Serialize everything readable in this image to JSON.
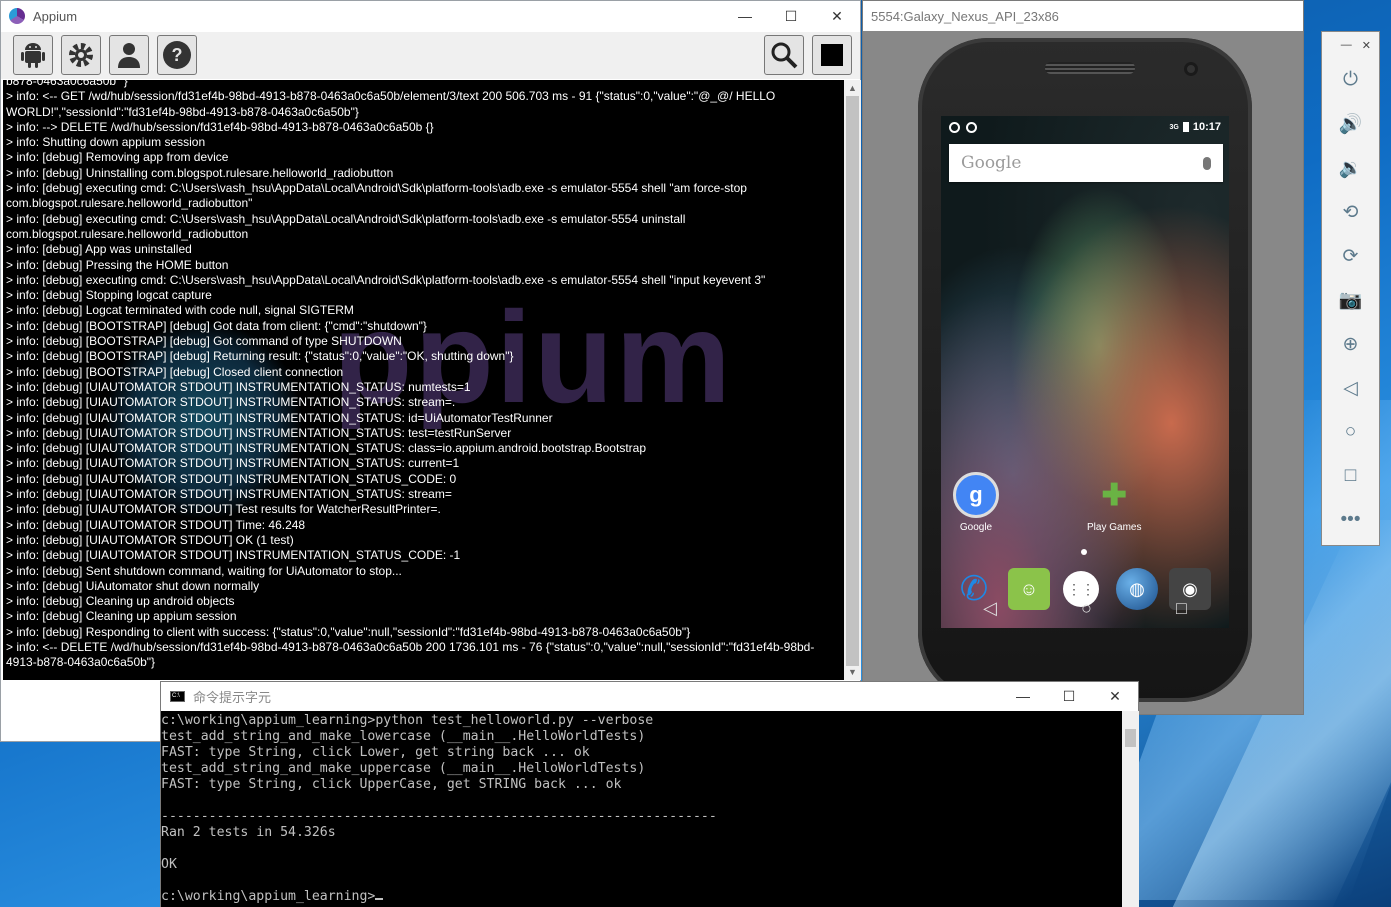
{
  "appium": {
    "title": "Appium",
    "toolbar": {
      "android_button": "android-icon",
      "settings_button": "gear-icon",
      "user_button": "user-icon",
      "help_button": "help-icon",
      "inspector_button": "magnifier-icon",
      "stop_button": "stop-icon"
    },
    "log_lines": [
      "b878-0463a0c6a50b\" }",
      "> info: <-- GET /wd/hub/session/fd31ef4b-98bd-4913-b878-0463a0c6a50b/element/3/text 200 506.703 ms - 91 {\"status\":0,\"value\":\"@_@/ HELLO WORLD!\",\"sessionId\":\"fd31ef4b-98bd-4913-b878-0463a0c6a50b\"}",
      "> info: --> DELETE /wd/hub/session/fd31ef4b-98bd-4913-b878-0463a0c6a50b {}",
      "> info: Shutting down appium session",
      "> info: [debug] Removing app from device",
      "> info: [debug] Uninstalling com.blogspot.rulesare.helloworld_radiobutton",
      "> info: [debug] executing cmd: C:\\Users\\vash_hsu\\AppData\\Local\\Android\\Sdk\\platform-tools\\adb.exe -s emulator-5554 shell \"am force-stop com.blogspot.rulesare.helloworld_radiobutton\"",
      "> info: [debug] executing cmd: C:\\Users\\vash_hsu\\AppData\\Local\\Android\\Sdk\\platform-tools\\adb.exe -s emulator-5554 uninstall com.blogspot.rulesare.helloworld_radiobutton",
      "> info: [debug] App was uninstalled",
      "> info: [debug] Pressing the HOME button",
      "> info: [debug] executing cmd: C:\\Users\\vash_hsu\\AppData\\Local\\Android\\Sdk\\platform-tools\\adb.exe -s emulator-5554 shell \"input keyevent 3\"",
      "> info: [debug] Stopping logcat capture",
      "> info: [debug] Logcat terminated with code null, signal SIGTERM",
      "> info: [debug] [BOOTSTRAP] [debug] Got data from client: {\"cmd\":\"shutdown\"}",
      "> info: [debug] [BOOTSTRAP] [debug] Got command of type SHUTDOWN",
      "> info: [debug] [BOOTSTRAP] [debug] Returning result: {\"status\":0,\"value\":\"OK, shutting down\"}",
      "> info: [debug] [BOOTSTRAP] [debug] Closed client connection",
      "> info: [debug] [UIAUTOMATOR STDOUT] INSTRUMENTATION_STATUS: numtests=1",
      "> info: [debug] [UIAUTOMATOR STDOUT] INSTRUMENTATION_STATUS: stream=.",
      "> info: [debug] [UIAUTOMATOR STDOUT] INSTRUMENTATION_STATUS: id=UiAutomatorTestRunner",
      "> info: [debug] [UIAUTOMATOR STDOUT] INSTRUMENTATION_STATUS: test=testRunServer",
      "> info: [debug] [UIAUTOMATOR STDOUT] INSTRUMENTATION_STATUS: class=io.appium.android.bootstrap.Bootstrap",
      "> info: [debug] [UIAUTOMATOR STDOUT] INSTRUMENTATION_STATUS: current=1",
      "> info: [debug] [UIAUTOMATOR STDOUT] INSTRUMENTATION_STATUS_CODE: 0",
      "> info: [debug] [UIAUTOMATOR STDOUT] INSTRUMENTATION_STATUS: stream=",
      "> info: [debug] [UIAUTOMATOR STDOUT] Test results for WatcherResultPrinter=.",
      "> info: [debug] [UIAUTOMATOR STDOUT] Time: 46.248",
      "> info: [debug] [UIAUTOMATOR STDOUT] OK (1 test)",
      "> info: [debug] [UIAUTOMATOR STDOUT] INSTRUMENTATION_STATUS_CODE: -1",
      "> info: [debug] Sent shutdown command, waiting for UiAutomator to stop...",
      "> info: [debug] UiAutomator shut down normally",
      "> info: [debug] Cleaning up android objects",
      "> info: [debug] Cleaning up appium session",
      "> info: [debug] Responding to client with success: {\"status\":0,\"value\":null,\"sessionId\":\"fd31ef4b-98bd-4913-b878-0463a0c6a50b\"}",
      "> info: <-- DELETE /wd/hub/session/fd31ef4b-98bd-4913-b878-0463a0c6a50b 200 1736.101 ms - 76 {\"status\":0,\"value\":null,\"sessionId\":\"fd31ef4b-98bd-4913-b878-0463a0c6a50b\"}"
    ],
    "watermark": "ppium"
  },
  "emulator": {
    "title": "5554:Galaxy_Nexus_API_23x86",
    "status_time": "10:17",
    "status_signal": "3G",
    "search_placeholder": "Google",
    "apps": [
      {
        "label": "Google",
        "icon": "google-search-icon",
        "glyph": "g",
        "color": "#4285f4"
      },
      {
        "label": "Play Games",
        "icon": "gamepad-icon",
        "glyph": "✚",
        "color": "#6ab344"
      }
    ],
    "dock": [
      {
        "icon": "phone-icon",
        "glyph": "✆",
        "color": "#1e88e5"
      },
      {
        "icon": "messaging-icon",
        "glyph": "☺",
        "color": "#8bc34a"
      },
      {
        "icon": "app-drawer-icon",
        "glyph": "⋮⋮",
        "color": "#ffffff"
      },
      {
        "icon": "browser-globe-icon",
        "glyph": "◍",
        "color": "#2a6fb0"
      },
      {
        "icon": "camera-icon",
        "glyph": "◉",
        "color": "#555555"
      }
    ],
    "nav": [
      "◁",
      "○",
      "□"
    ]
  },
  "emu_sidebar": {
    "min_label": "—",
    "close_label": "✕",
    "buttons": [
      {
        "name": "power-icon",
        "glyph": "⏻"
      },
      {
        "name": "volume-up-icon",
        "glyph": "🔊"
      },
      {
        "name": "volume-down-icon",
        "glyph": "🔉"
      },
      {
        "name": "rotate-left-icon",
        "glyph": "⟲"
      },
      {
        "name": "rotate-right-icon",
        "glyph": "⟳"
      },
      {
        "name": "screenshot-icon",
        "glyph": "📷"
      },
      {
        "name": "zoom-icon",
        "glyph": "⊕"
      },
      {
        "name": "back-icon",
        "glyph": "◁"
      },
      {
        "name": "home-icon",
        "glyph": "○"
      },
      {
        "name": "overview-icon",
        "glyph": "□"
      },
      {
        "name": "more-icon",
        "glyph": "•••"
      }
    ]
  },
  "cmd": {
    "title": "命令提示字元",
    "lines": [
      "c:\\working\\appium_learning>python test_helloworld.py --verbose",
      "test_add_string_and_make_lowercase (__main__.HelloWorldTests)",
      "FAST: type String, click Lower, get string back ... ok",
      "test_add_string_and_make_uppercase (__main__.HelloWorldTests)",
      "FAST: type String, click UpperCase, get STRING back ... ok",
      "",
      "----------------------------------------------------------------------",
      "Ran 2 tests in 54.326s",
      "",
      "OK",
      "",
      "c:\\working\\appium_learning>"
    ]
  },
  "window_controls": {
    "minimize": "—",
    "maximize": "☐",
    "close": "✕"
  }
}
